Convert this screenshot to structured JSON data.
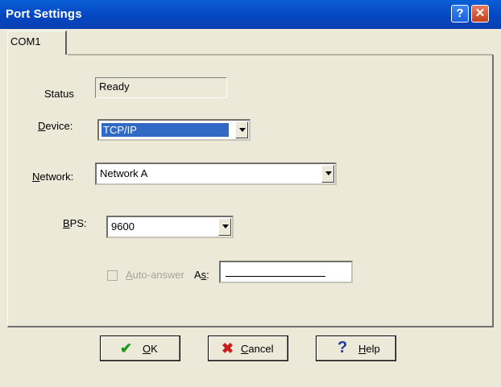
{
  "window": {
    "title": "Port Settings"
  },
  "tabs": [
    {
      "label": "COM1"
    }
  ],
  "form": {
    "status_label": "Status",
    "status_value": "Ready",
    "device_label_ul": "D",
    "device_label_rest": "evice:",
    "device_value": "TCP/IP",
    "network_label_ul": "N",
    "network_label_rest": "etwork:",
    "network_value": "Network A",
    "bps_label_ul": "B",
    "bps_label_rest": "PS:",
    "bps_value": "9600",
    "auto_answer_ul": "A",
    "auto_answer_rest": "uto-answer",
    "as_label_pre": "A",
    "as_label_ul": "s",
    "as_label_post": ":",
    "auto_answer_checked": false
  },
  "buttons": {
    "ok_ul": "O",
    "ok_rest": "K",
    "cancel_ul": "C",
    "cancel_rest": "ancel",
    "help_ul": "H",
    "help_rest": "elp"
  },
  "icons": {
    "help": "question-mark-icon",
    "close": "close-icon",
    "ok": "checkmark-icon",
    "cancel": "x-mark-icon",
    "help_button": "question-mark-icon"
  },
  "colors": {
    "title_bar": "#0a5fd6",
    "selection": "#316ac5",
    "dialog_face": "#ece9d8"
  }
}
